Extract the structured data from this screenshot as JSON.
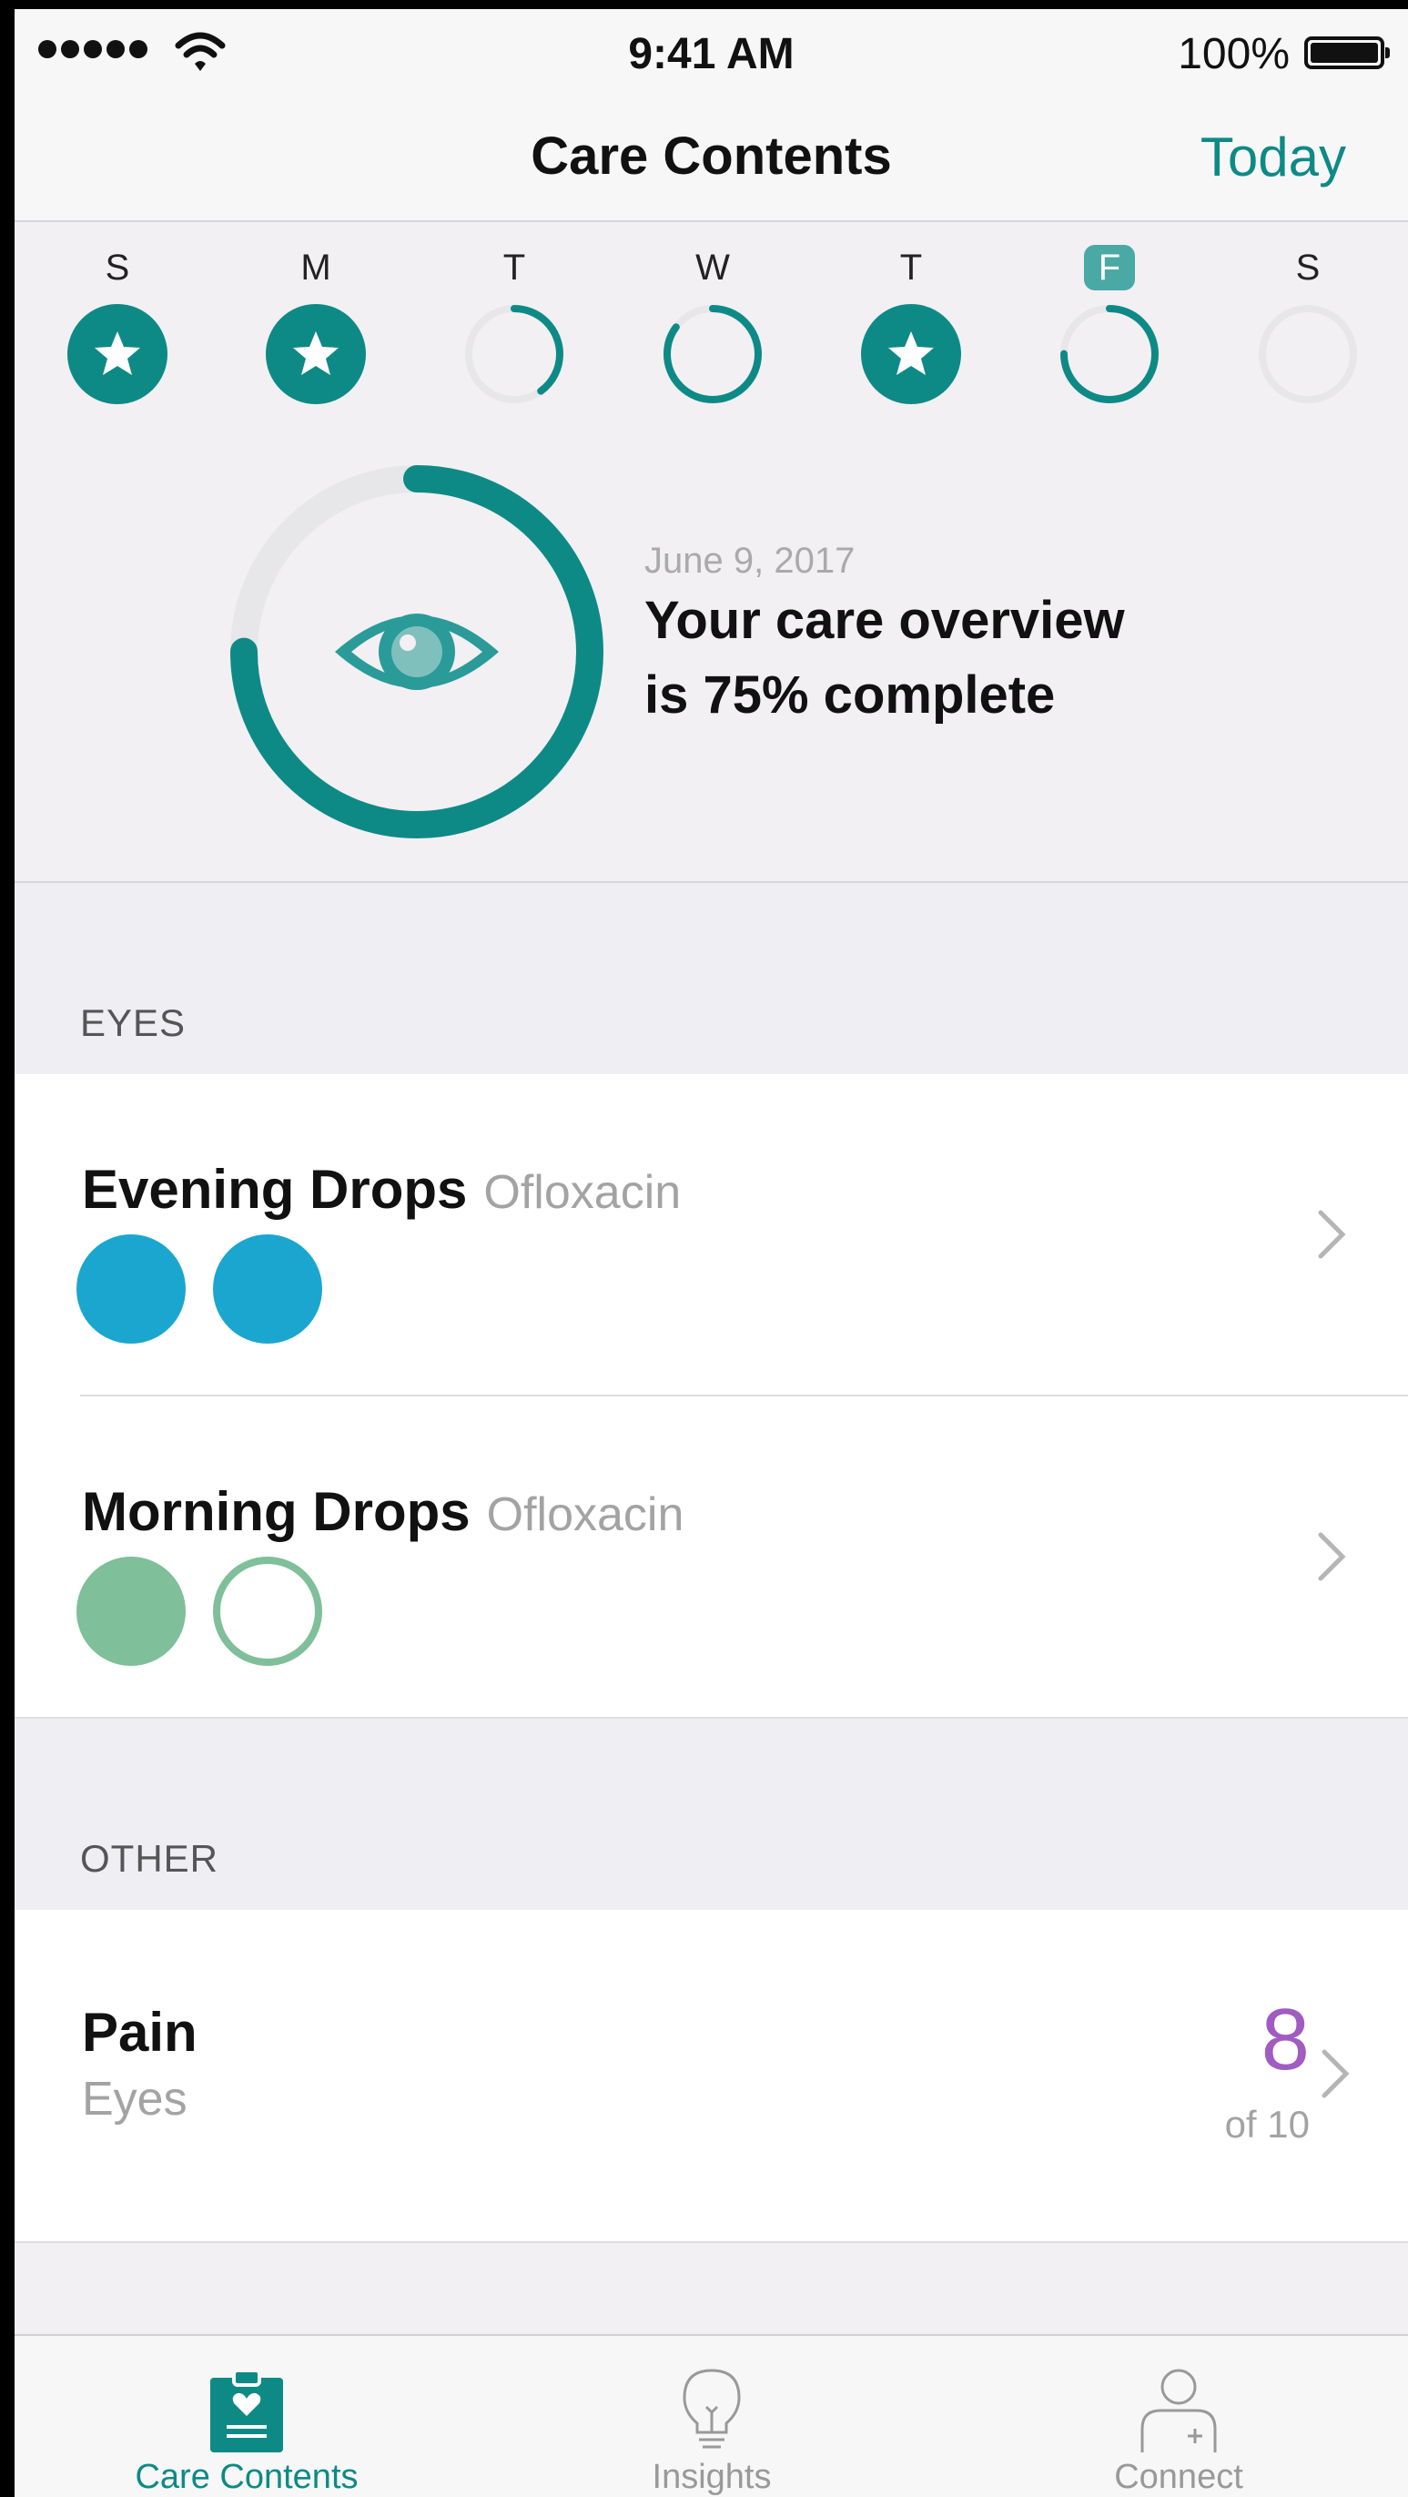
{
  "status_bar": {
    "time": "9:41 AM",
    "battery": "100%"
  },
  "nav": {
    "title": "Care Contents",
    "today_label": "Today"
  },
  "week": {
    "days": [
      {
        "letter": "S",
        "state": "complete",
        "progress": 1.0
      },
      {
        "letter": "M",
        "state": "complete",
        "progress": 1.0
      },
      {
        "letter": "T",
        "state": "partial",
        "progress": 0.4
      },
      {
        "letter": "W",
        "state": "partial",
        "progress": 0.85
      },
      {
        "letter": "T",
        "state": "complete",
        "progress": 1.0
      },
      {
        "letter": "F",
        "state": "partial",
        "progress": 0.75,
        "selected": true
      },
      {
        "letter": "S",
        "state": "empty",
        "progress": 0
      }
    ]
  },
  "overview": {
    "date": "June 9, 2017",
    "line1": "Your care overview",
    "line2": "is 75% complete",
    "progress": 0.75,
    "icon": "eye-icon"
  },
  "sections": {
    "eyes": {
      "label": "EYES",
      "rows": [
        {
          "title": "Evening Drops",
          "subtitle": "Ofloxacin",
          "events": [
            "filled",
            "filled"
          ],
          "color": "#1ba6cf"
        },
        {
          "title": "Morning Drops",
          "subtitle": "Ofloxacin",
          "events": [
            "filled",
            "empty"
          ],
          "color": "#7fbf99"
        }
      ]
    },
    "other": {
      "label": "OTHER",
      "pain": {
        "title": "Pain",
        "subtitle": "Eyes",
        "value": "8",
        "of": "of 10",
        "color": "#a05cc0"
      }
    }
  },
  "tabs": [
    {
      "label": "Care Contents",
      "icon": "clipboard-heart-icon",
      "active": true
    },
    {
      "label": "Insights",
      "icon": "lightbulb-icon",
      "active": false
    },
    {
      "label": "Connect",
      "icon": "person-plus-icon",
      "active": false
    }
  ],
  "colors": {
    "accent": "#0e8a86",
    "ring_track": "#e7e7ea",
    "drops_blue": "#1ba6cf",
    "drops_green": "#7fbf99",
    "pain_purple": "#a05cc0"
  }
}
